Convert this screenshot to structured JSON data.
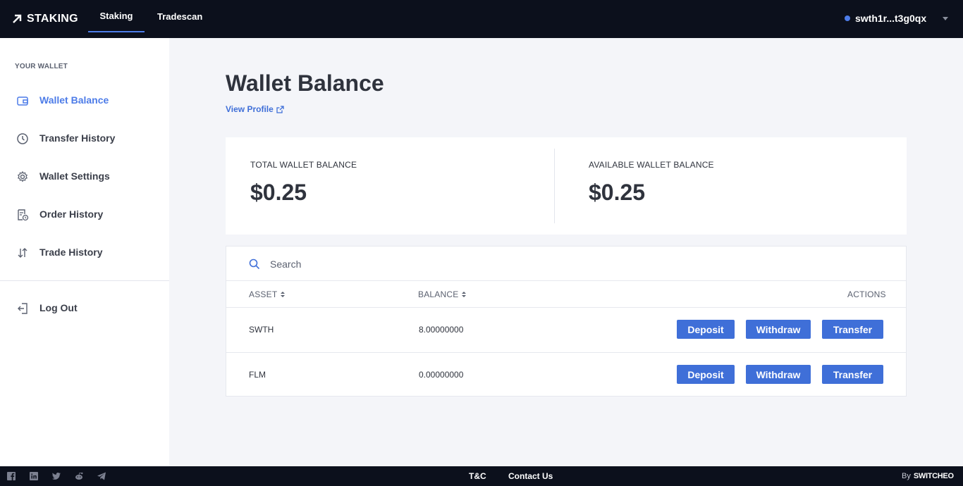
{
  "header": {
    "logo_text": "STAKING",
    "tabs": [
      {
        "label": "Staking",
        "active": true
      },
      {
        "label": "Tradescan",
        "active": false
      }
    ],
    "wallet_address": "swth1r...t3g0qx",
    "accent_color": "#4d7ce8"
  },
  "sidebar": {
    "heading": "YOUR WALLET",
    "items": [
      {
        "label": "Wallet Balance",
        "icon": "wallet-icon",
        "active": true
      },
      {
        "label": "Transfer History",
        "icon": "clock-icon",
        "active": false
      },
      {
        "label": "Wallet Settings",
        "icon": "gear-icon",
        "active": false
      },
      {
        "label": "Order History",
        "icon": "document-clock-icon",
        "active": false
      },
      {
        "label": "Trade History",
        "icon": "swap-arrows-icon",
        "active": false
      }
    ],
    "logout_label": "Log Out"
  },
  "main": {
    "title": "Wallet Balance",
    "view_profile_label": "View Profile",
    "total_balance": {
      "label": "TOTAL WALLET BALANCE",
      "value": "$0.25"
    },
    "available_balance": {
      "label": "AVAILABLE WALLET BALANCE",
      "value": "$0.25"
    },
    "search": {
      "placeholder": "Search",
      "value": ""
    },
    "table": {
      "columns": {
        "asset": "ASSET",
        "balance": "BALANCE",
        "actions": "ACTIONS"
      },
      "rows": [
        {
          "asset": "SWTH",
          "balance": "8.00000000"
        },
        {
          "asset": "FLM",
          "balance": "0.00000000"
        }
      ],
      "actions": {
        "deposit": "Deposit",
        "withdraw": "Withdraw",
        "transfer": "Transfer"
      }
    }
  },
  "footer": {
    "social_icons": [
      "facebook-icon",
      "linkedin-icon",
      "twitter-icon",
      "reddit-icon",
      "telegram-icon"
    ],
    "links": {
      "terms": "T&C",
      "contact": "Contact Us"
    },
    "by_label": "By",
    "brand": "SWITCHEO"
  }
}
